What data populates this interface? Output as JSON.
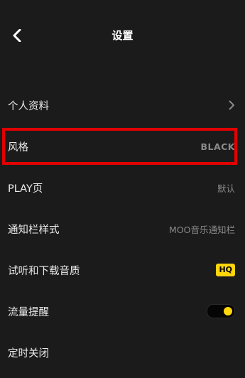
{
  "header": {
    "title": "设置"
  },
  "settings": {
    "items": [
      {
        "label": "个人资料",
        "value": "",
        "kind": "chevron"
      },
      {
        "label": "风格",
        "value": "BLACK",
        "kind": "text"
      },
      {
        "label": "PLAY页",
        "value": "默认",
        "kind": "text"
      },
      {
        "label": "通知栏样式",
        "value": "MOO音乐通知栏",
        "kind": "text"
      },
      {
        "label": "试听和下载音质",
        "value": "HQ",
        "kind": "badge"
      },
      {
        "label": "流量提醒",
        "value": "",
        "kind": "toggle",
        "toggle_on": true
      },
      {
        "label": "定时关闭",
        "value": "",
        "kind": "none"
      }
    ]
  },
  "icons": {
    "back": "chevron-left-icon",
    "chevron": "chevron-right-icon"
  },
  "colors": {
    "background": "#1b1b1b",
    "accent": "#ffd60a",
    "highlight": "#e00000"
  }
}
